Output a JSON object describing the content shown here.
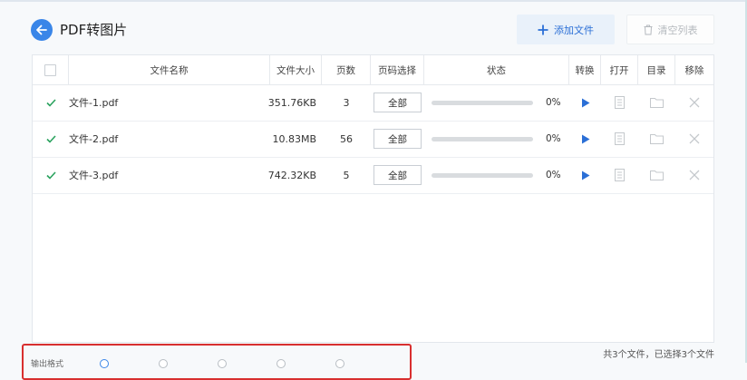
{
  "header": {
    "title": "PDF转图片",
    "add_label": "添加文件",
    "clear_label": "清空列表"
  },
  "table": {
    "columns": {
      "name": "文件名称",
      "size": "文件大小",
      "pages": "页数",
      "page_select": "页码选择",
      "status": "状态",
      "convert": "转换",
      "open": "打开",
      "dir": "目录",
      "remove": "移除"
    },
    "rows": [
      {
        "name": "文件-1.pdf",
        "size": "351.76KB",
        "pages": "3",
        "page_select": "全部",
        "progress": 0,
        "pct": "0%"
      },
      {
        "name": "文件-2.pdf",
        "size": "10.83MB",
        "pages": "56",
        "page_select": "全部",
        "progress": 0,
        "pct": "0%"
      },
      {
        "name": "文件-3.pdf",
        "size": "742.32KB",
        "pages": "5",
        "page_select": "全部",
        "progress": 0,
        "pct": "0%"
      }
    ]
  },
  "footer": {
    "status": "共3个文件，已选择3个文件",
    "output_label": "输出格式"
  },
  "colors": {
    "accent": "#3a86e8",
    "highlight": "#d82f2f"
  }
}
